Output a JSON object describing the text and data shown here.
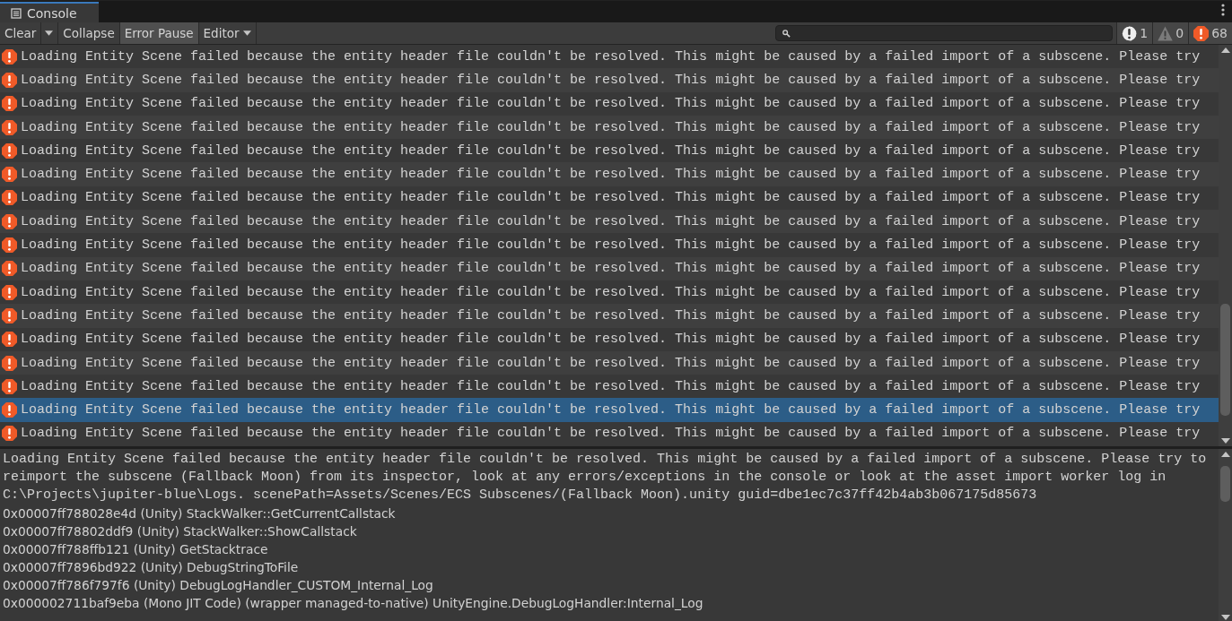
{
  "tab": {
    "title": "Console"
  },
  "toolbar": {
    "buttons": [
      {
        "kind": "split",
        "label": "Clear"
      },
      {
        "kind": "toggle",
        "label": "Collapse",
        "on": false
      },
      {
        "kind": "toggle",
        "label": "Error Pause",
        "on": true
      },
      {
        "kind": "dropdown",
        "label": "Editor"
      }
    ],
    "counters": [
      {
        "kind": "info",
        "count": "1"
      },
      {
        "kind": "warning",
        "count": "0"
      },
      {
        "kind": "error",
        "count": "68"
      }
    ]
  },
  "log": {
    "entries": [
      {
        "kind": "error",
        "text": "Loading Entity Scene failed because the entity header file couldn't be resolved. This might be caused by a failed import of a subscene. Please try",
        "selected": false
      },
      {
        "kind": "error",
        "text": "Loading Entity Scene failed because the entity header file couldn't be resolved. This might be caused by a failed import of a subscene. Please try",
        "selected": false
      },
      {
        "kind": "error",
        "text": "Loading Entity Scene failed because the entity header file couldn't be resolved. This might be caused by a failed import of a subscene. Please try",
        "selected": false
      },
      {
        "kind": "error",
        "text": "Loading Entity Scene failed because the entity header file couldn't be resolved. This might be caused by a failed import of a subscene. Please try",
        "selected": false
      },
      {
        "kind": "error",
        "text": "Loading Entity Scene failed because the entity header file couldn't be resolved. This might be caused by a failed import of a subscene. Please try",
        "selected": false
      },
      {
        "kind": "error",
        "text": "Loading Entity Scene failed because the entity header file couldn't be resolved. This might be caused by a failed import of a subscene. Please try",
        "selected": false
      },
      {
        "kind": "error",
        "text": "Loading Entity Scene failed because the entity header file couldn't be resolved. This might be caused by a failed import of a subscene. Please try",
        "selected": false
      },
      {
        "kind": "error",
        "text": "Loading Entity Scene failed because the entity header file couldn't be resolved. This might be caused by a failed import of a subscene. Please try",
        "selected": false
      },
      {
        "kind": "error",
        "text": "Loading Entity Scene failed because the entity header file couldn't be resolved. This might be caused by a failed import of a subscene. Please try",
        "selected": false
      },
      {
        "kind": "error",
        "text": "Loading Entity Scene failed because the entity header file couldn't be resolved. This might be caused by a failed import of a subscene. Please try",
        "selected": false
      },
      {
        "kind": "error",
        "text": "Loading Entity Scene failed because the entity header file couldn't be resolved. This might be caused by a failed import of a subscene. Please try",
        "selected": false
      },
      {
        "kind": "error",
        "text": "Loading Entity Scene failed because the entity header file couldn't be resolved. This might be caused by a failed import of a subscene. Please try",
        "selected": false
      },
      {
        "kind": "error",
        "text": "Loading Entity Scene failed because the entity header file couldn't be resolved. This might be caused by a failed import of a subscene. Please try",
        "selected": false
      },
      {
        "kind": "error",
        "text": "Loading Entity Scene failed because the entity header file couldn't be resolved. This might be caused by a failed import of a subscene. Please try",
        "selected": false
      },
      {
        "kind": "error",
        "text": "Loading Entity Scene failed because the entity header file couldn't be resolved. This might be caused by a failed import of a subscene. Please try",
        "selected": false
      },
      {
        "kind": "error",
        "text": "Loading Entity Scene failed because the entity header file couldn't be resolved. This might be caused by a failed import of a subscene. Please try",
        "selected": true
      },
      {
        "kind": "error",
        "text": "Loading Entity Scene failed because the entity header file couldn't be resolved. This might be caused by a failed import of a subscene. Please try",
        "selected": false
      }
    ]
  },
  "detail": {
    "message": "Loading Entity Scene failed because the entity header file couldn't be resolved. This might be caused by a failed import of a subscene. Please try to reimport the subscene (Fallback Moon) from its inspector, look at any errors/exceptions in the console or look at the asset import worker log in C:\\Projects\\jupiter-blue\\Logs. scenePath=Assets/Scenes/ECS Subscenes/(Fallback Moon).unity guid=dbe1ec7c37ff42b4ab3b067175d85673",
    "stack": [
      "0x00007ff788028e4d (Unity) StackWalker::GetCurrentCallstack",
      "0x00007ff78802ddf9 (Unity) StackWalker::ShowCallstack",
      "0x00007ff788ffb121 (Unity) GetStacktrace",
      "0x00007ff7896bd922 (Unity) DebugStringToFile",
      "0x00007ff786f797f6 (Unity) DebugLogHandler_CUSTOM_Internal_Log",
      "0x000002711baf9eba (Mono JIT Code) (wrapper managed-to-native) UnityEngine.DebugLogHandler:Internal_Log"
    ]
  }
}
